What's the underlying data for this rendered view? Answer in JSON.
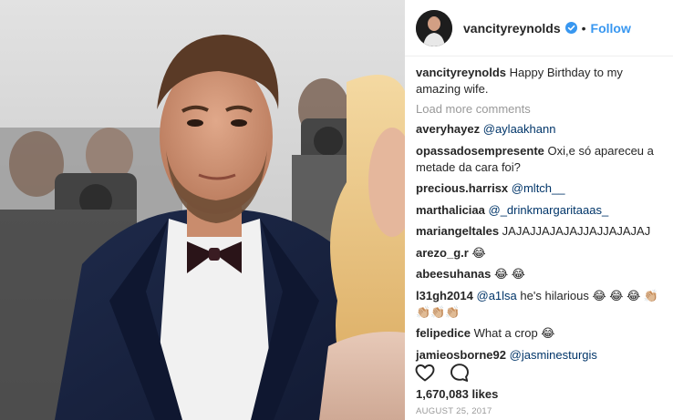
{
  "post": {
    "username": "vancityreynolds",
    "follow_label": "Follow",
    "separator": "•",
    "caption_text": "Happy Birthday to my amazing wife.",
    "load_more_label": "Load more comments",
    "likes_text": "1,670,083 likes",
    "date_text": "AUGUST 25, 2017"
  },
  "comments": [
    {
      "user": "averyhayez",
      "mention": "@aylaakhann",
      "text": ""
    },
    {
      "user": "opassadosempresente",
      "mention": "",
      "text": "Oxi,e só apareceu a metade da cara foi?"
    },
    {
      "user": "precious.harrisx",
      "mention": "@mltch__",
      "text": ""
    },
    {
      "user": "marthaliciaa",
      "mention": "@_drinkmargaritaaas_",
      "text": ""
    },
    {
      "user": "mariangeltales",
      "mention": "",
      "text": "JAJAJJAJAJAJJAJJAJAJAJ"
    },
    {
      "user": "arezo_g.r",
      "mention": "",
      "text": "😂"
    },
    {
      "user": "abeesuhanas",
      "mention": "",
      "text": "😂 😂"
    },
    {
      "user": "l31gh2014",
      "mention": "@a1lsa",
      "text": "he's hilarious 😂 😂 😂 👏🏼👏🏼👏🏼👏🏼"
    },
    {
      "user": "felipedice",
      "mention": "",
      "text": "What a crop 😂"
    },
    {
      "user": "jamieosborne92",
      "mention": "@jasminesturgis",
      "text": ""
    }
  ],
  "colors": {
    "link_blue": "#3897f0",
    "mention_blue": "#003569",
    "muted_gray": "#999999",
    "verified_blue": "#3897f0"
  },
  "icons": {
    "like": "heart-outline-icon",
    "comment": "speech-bubble-icon",
    "verified": "verified-badge-icon"
  }
}
